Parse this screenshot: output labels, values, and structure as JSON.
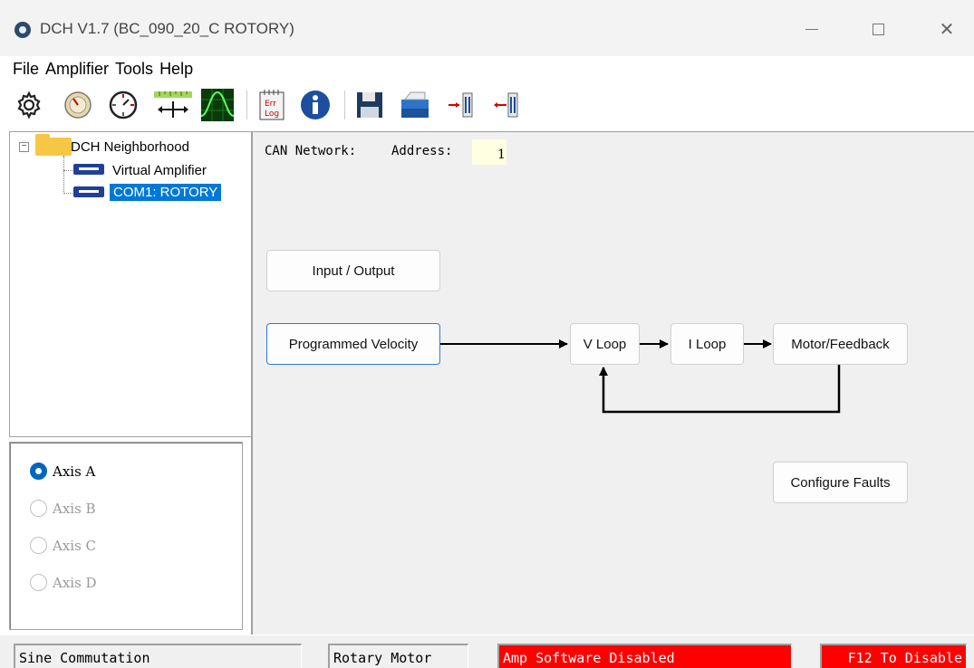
{
  "window": {
    "title": "DCH V1.7 (BC_090_20_C ROTORY)"
  },
  "menu": [
    "File",
    "Amplifier",
    "Tools",
    "Help"
  ],
  "toolbar": {
    "icons": [
      "gear-icon",
      "gauge-icon",
      "clock-icon",
      "ruler-move-icon",
      "scope-icon",
      "error-log-icon",
      "info-icon",
      "save-icon",
      "open-icon",
      "upload-icon",
      "download-icon"
    ],
    "error_log_text_1": "Err",
    "error_log_text_2": "Log"
  },
  "tree": {
    "root": "DCH Neighborhood",
    "children": [
      "Virtual Amplifier",
      "COM1: ROTORY"
    ],
    "selected": "COM1: ROTORY"
  },
  "axes": {
    "items": [
      {
        "label": "Axis A",
        "checked": true,
        "enabled": true
      },
      {
        "label": "Axis B",
        "checked": false,
        "enabled": false
      },
      {
        "label": "Axis C",
        "checked": false,
        "enabled": false
      },
      {
        "label": "Axis D",
        "checked": false,
        "enabled": false
      }
    ]
  },
  "main": {
    "can_network_label": "CAN Network:",
    "address_label": "Address:",
    "address_value": "1",
    "buttons": {
      "input_output": "Input / Output",
      "programmed_velocity": "Programmed Velocity",
      "v_loop": "V Loop",
      "i_loop": "I Loop",
      "motor_feedback": "Motor/Feedback",
      "configure_faults": "Configure Faults"
    }
  },
  "status": {
    "commutation": "Sine Commutation",
    "motor": "Rotary Motor",
    "amp_state": "Amp Software Disabled",
    "hint": "F12 To Disable"
  },
  "colors": {
    "selection": "#0078d7",
    "status_alert": "#ff0000",
    "address_field": "#ffffe1",
    "panel_bg": "#f0f0f0"
  }
}
